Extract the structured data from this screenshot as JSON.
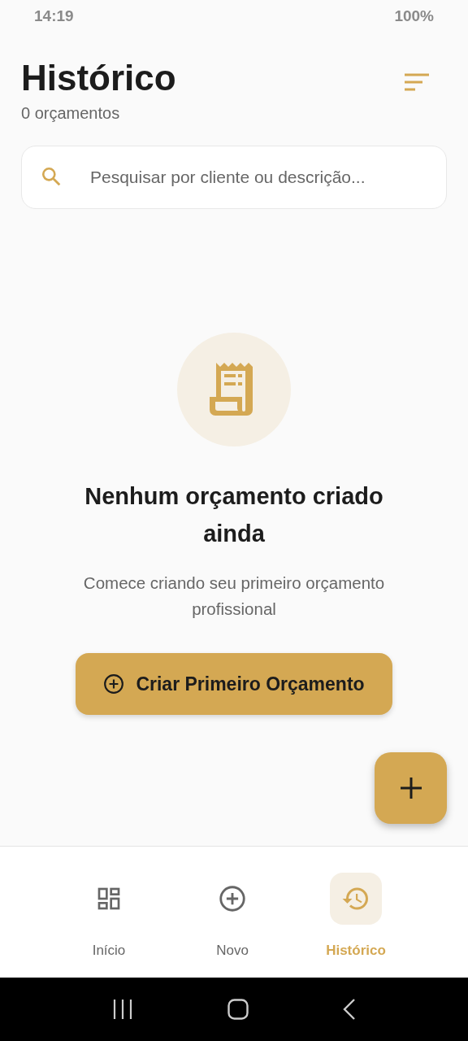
{
  "status_bar": {
    "time": "14:19",
    "battery": "100%"
  },
  "header": {
    "title": "Histórico",
    "subtitle": "0 orçamentos"
  },
  "search": {
    "placeholder": "Pesquisar por cliente ou descrição..."
  },
  "empty_state": {
    "title": "Nenhum orçamento criado ainda",
    "description": "Comece criando seu primeiro orçamento profissional",
    "button": "Criar Primeiro Orçamento"
  },
  "bottom_nav": [
    {
      "label": "Início",
      "kind": "dashboard",
      "selected": false
    },
    {
      "label": "Novo",
      "kind": "add",
      "selected": false
    },
    {
      "label": "Histórico",
      "kind": "history",
      "selected": true
    }
  ]
}
